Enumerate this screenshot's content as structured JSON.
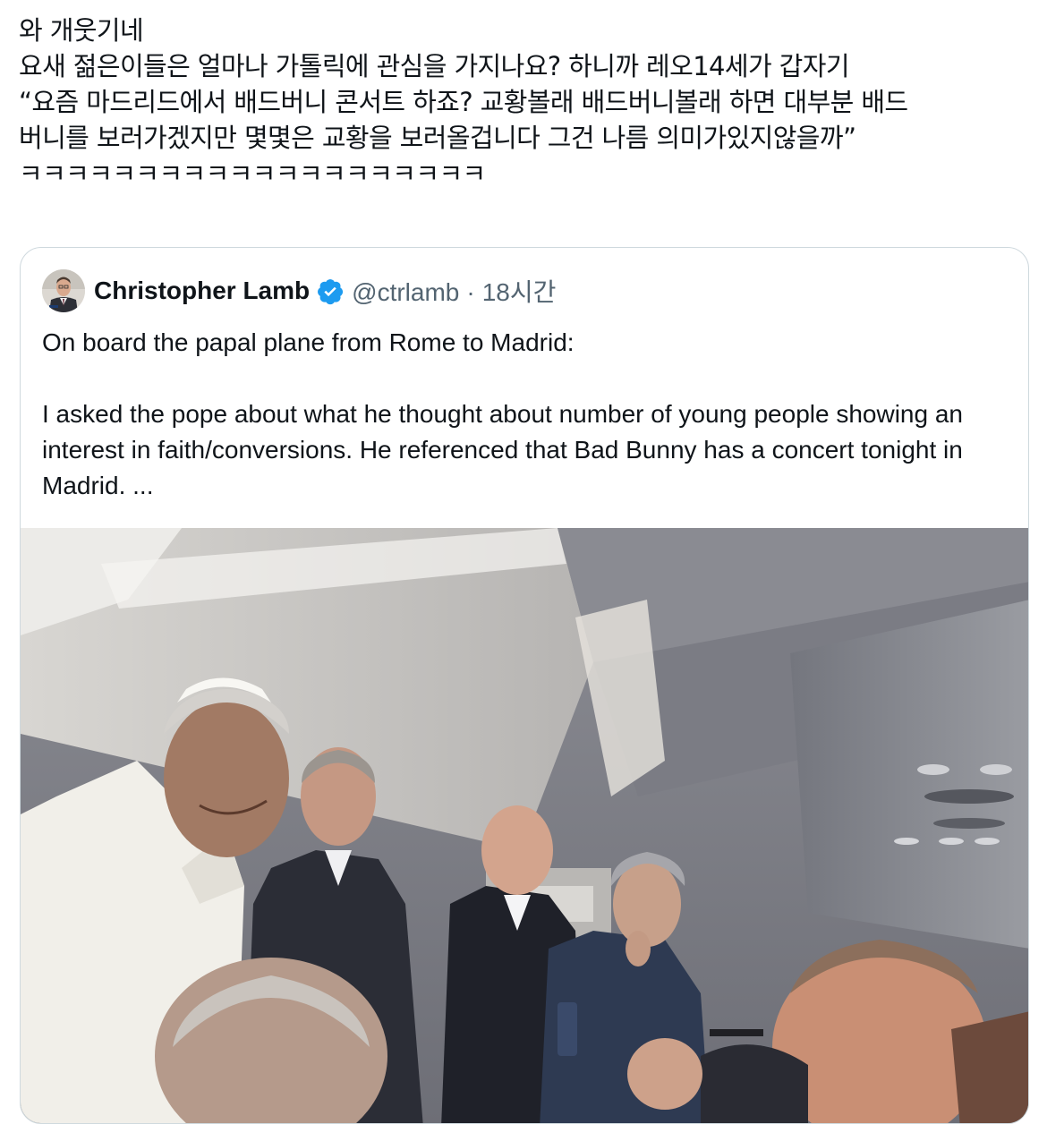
{
  "post": {
    "lines": [
      "와 개웃기네",
      "요새 젊은이들은 얼마나 가톨릭에 관심을 가지나요? 하니까 레오14세가 갑자기",
      "“요즘 마드리드에서 배드버니 콘서트 하죠? 교황볼래 배드버니볼래 하면 대부분 배드",
      "버니를 보러가겠지만 몇몇은 교황을 보러올겁니다 그건 나름 의미가있지않을까”",
      "ㅋㅋㅋㅋㅋㅋㅋㅋㅋㅋㅋㅋㅋㅋㅋㅋㅋㅋㅋㅋ"
    ]
  },
  "quoted_post": {
    "author_name": "Christopher Lamb",
    "handle": "@ctrlamb",
    "separator": "·",
    "time_ago": "18시간",
    "paragraphs": [
      "On board the papal plane from Rome to Madrid:",
      "I asked the pope about what he thought about number of young people showing an interest in faith/conversions. He referenced that Bad Bunny has a concert tonight in Madrid. ..."
    ],
    "icons": {
      "avatar": "author-avatar",
      "verified": "verified-badge-icon"
    },
    "media": "photo"
  },
  "colors": {
    "text": "#0f1419",
    "secondary": "#536471",
    "border": "#cfd9de",
    "verified": "#1d9bf0"
  }
}
